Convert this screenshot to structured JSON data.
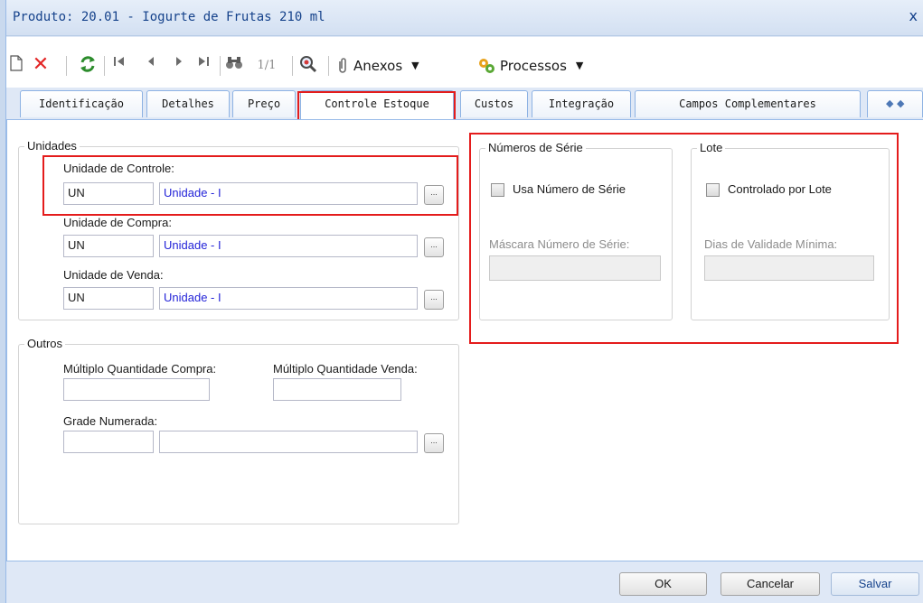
{
  "window": {
    "title": "Produto: 20.01 - Iogurte de Frutas 210 ml",
    "close": "x"
  },
  "toolbar": {
    "record_counter": "1/1",
    "attachments_label": "Anexos",
    "processes_label": "Processos",
    "caret": "▼"
  },
  "tabs": [
    {
      "label": "Identificação"
    },
    {
      "label": "Detalhes"
    },
    {
      "label": "Preço"
    },
    {
      "label": "Controle Estoque"
    },
    {
      "label": "Custos"
    },
    {
      "label": "Integração"
    },
    {
      "label": "Campos Complementares"
    }
  ],
  "active_tab": "Controle Estoque",
  "units": {
    "legend": "Unidades",
    "control": {
      "label": "Unidade de Controle:",
      "code": "UN",
      "description": "Unidade - I"
    },
    "purchase": {
      "label": "Unidade de Compra:",
      "code": "UN",
      "description": "Unidade - I"
    },
    "sale": {
      "label": "Unidade de Venda:",
      "code": "UN",
      "description": "Unidade - I"
    },
    "lookup_label": "..."
  },
  "others": {
    "legend": "Outros",
    "purchase_multiple_label": "Múltiplo Quantidade Compra:",
    "purchase_multiple_value": "",
    "sale_multiple_label": "Múltiplo Quantidade Venda:",
    "sale_multiple_value": "",
    "numbered_grid_label": "Grade Numerada:",
    "numbered_grid_code": "",
    "numbered_grid_description": ""
  },
  "serial": {
    "legend": "Números de Série",
    "use_label": "Usa Número de Série",
    "use_checked": false,
    "mask_label": "Máscara Número de Série:",
    "mask_value": ""
  },
  "lot": {
    "legend": "Lote",
    "controlled_label": "Controlado por Lote",
    "controlled_checked": false,
    "min_validity_label": "Dias de Validade Mínima:",
    "min_validity_value": ""
  },
  "footer": {
    "ok_label": "OK",
    "cancel_label": "Cancelar",
    "save_label": "Salvar"
  },
  "colors": {
    "accent": "#15428b",
    "highlight": "#e41c1c",
    "link_value": "#2424d8"
  }
}
